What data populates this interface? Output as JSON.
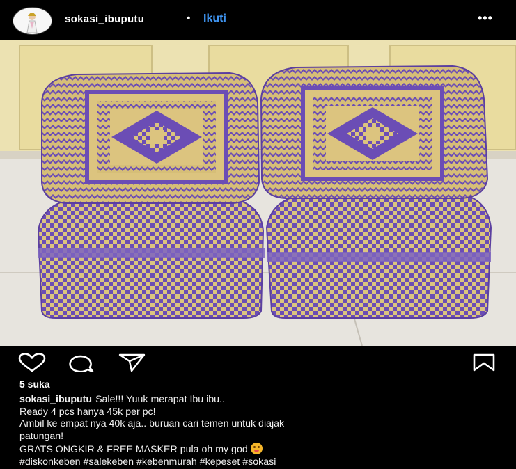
{
  "header": {
    "username": "sokasi_ibuputu",
    "separator": "•",
    "follow_label": "Ikuti",
    "more_label": "•••"
  },
  "post": {
    "image_icon": "woven-basket-photo",
    "likes": "5 suka",
    "caption_user": "sokasi_ibuputu",
    "caption_lines": [
      "Sale!!! Yuuk merapat Ibu ibu..",
      "Ready 4 pcs hanya 45k per pc!",
      "Ambil ke empat nya 40k aja.. buruan cari temen untuk diajak",
      "patungan!",
      "GRATS ONGKIR & FREE MASKER pula oh my god",
      "#diskonkeben #salekeben #kebenmurah #kepeset #sokasi"
    ]
  },
  "icons": {
    "like": "heart-icon",
    "comment": "comment-icon",
    "share": "send-icon",
    "save": "bookmark-icon",
    "emoji": "smiling-face-emoji"
  },
  "colors": {
    "background": "#000000",
    "follow": "#3f95f2",
    "basket_purple": "#6a4cb3",
    "basket_straw": "#d9c27a"
  }
}
